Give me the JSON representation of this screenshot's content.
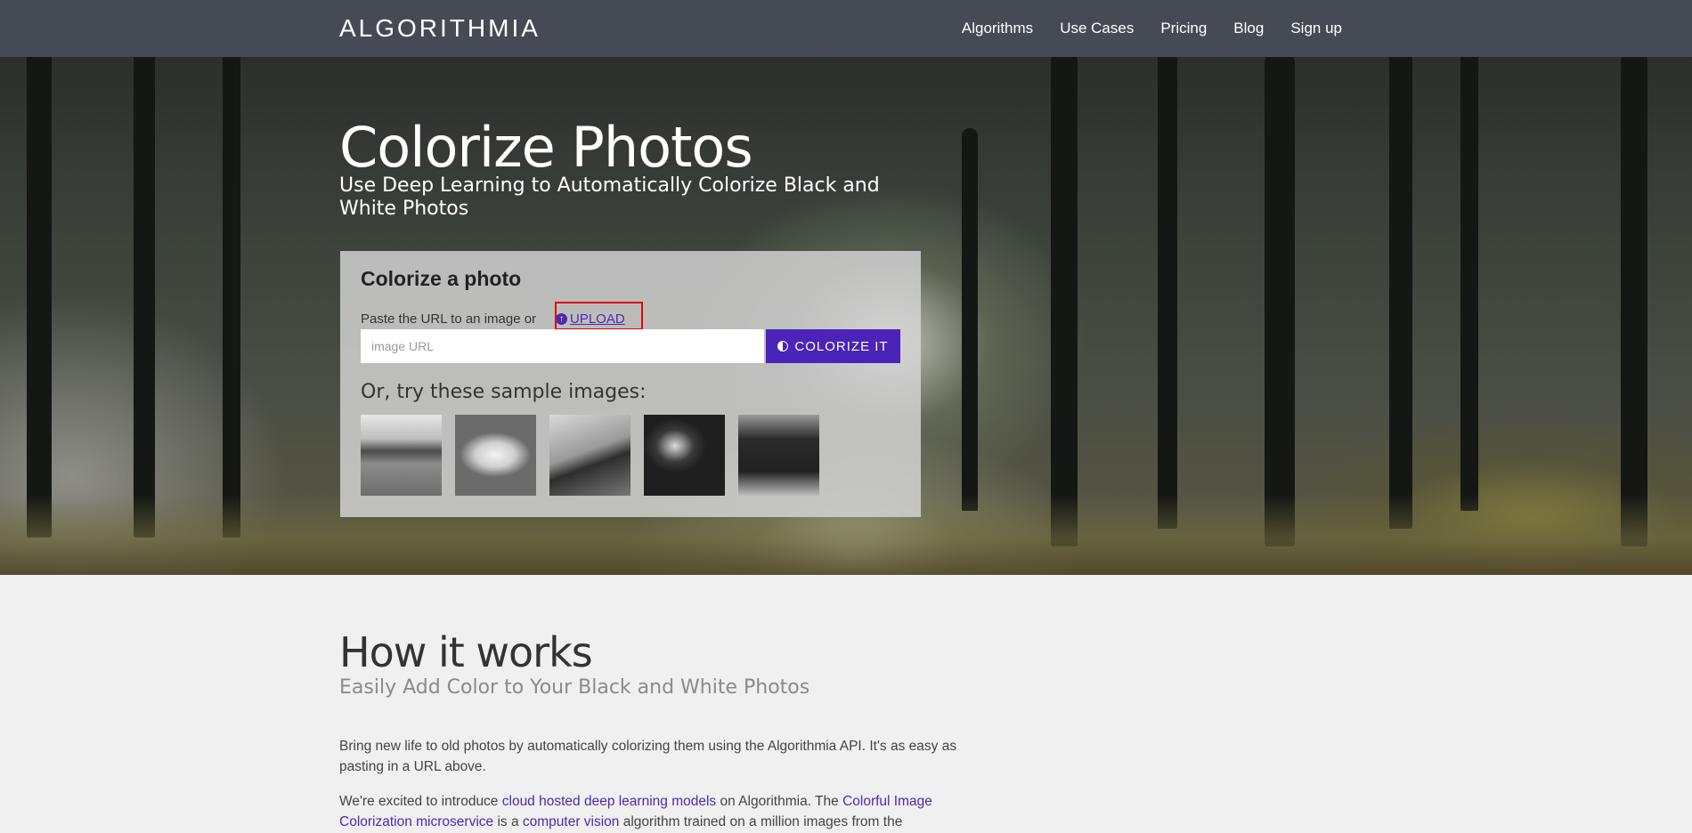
{
  "nav": {
    "logo": "ALGORITHMIA",
    "links": [
      "Algorithms",
      "Use Cases",
      "Pricing",
      "Blog",
      "Sign up"
    ]
  },
  "hero": {
    "title": "Colorize Photos",
    "subtitle": "Use Deep Learning to Automatically Colorize Black and White Photos"
  },
  "card": {
    "title": "Colorize a photo",
    "instruction": "Paste the URL to an image or",
    "upload_label": "UPLOAD",
    "url_placeholder": "image URL",
    "button_label": "COLORIZE IT",
    "samples_label": "Or, try these sample images:",
    "samples": [
      "sample-shoreline-bird",
      "sample-race-car",
      "sample-mountain-shepherd",
      "sample-portrait-woman",
      "sample-cattle"
    ]
  },
  "how": {
    "title": "How it works",
    "subtitle": "Easily Add Color to Your Black and White Photos",
    "p1": "Bring new life to old photos by automatically colorizing them using the Algorithmia API. It's as easy as pasting in a URL above.",
    "p2_a": "We're excited to introduce ",
    "p2_link1": "cloud hosted deep learning models",
    "p2_b": " on Algorithmia. The ",
    "p2_link2": "Colorful Image Colorization microservice",
    "p2_c": " is a ",
    "p2_link3": "computer vision",
    "p2_d": " algorithm trained on a million images from the"
  },
  "colors": {
    "nav_bg": "#454a55",
    "accent": "#4a23b8",
    "highlight": "#e00000"
  },
  "icons": {
    "upload": "upload-circle-icon",
    "colorize": "half-circle-icon"
  }
}
